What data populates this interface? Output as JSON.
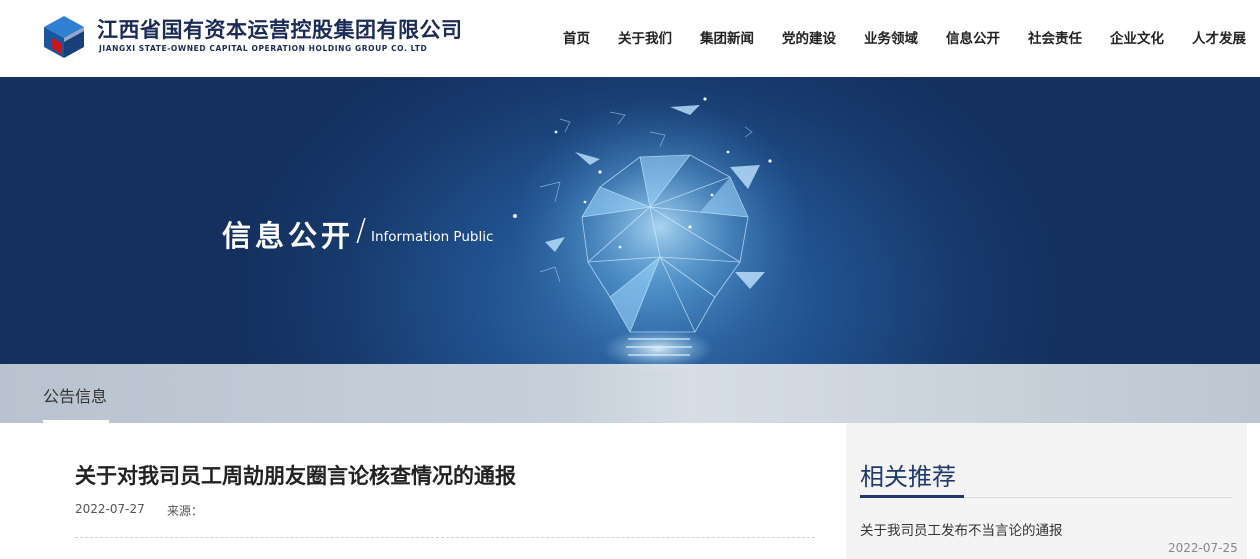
{
  "brand": {
    "name_cn": "江西省国有资本运营控股集团有限公司",
    "name_en": "JIANGXI STATE-OWNED CAPITAL OPERATION HOLDING GROUP CO. LTD"
  },
  "nav": {
    "items": [
      "首页",
      "关于我们",
      "集团新闻",
      "党的建设",
      "业务领域",
      "信息公开",
      "社会责任",
      "企业文化",
      "人才发展"
    ]
  },
  "banner": {
    "title": "信息公开",
    "subtitle": "Information Public"
  },
  "subnav": {
    "active_label": "公告信息"
  },
  "article": {
    "title": "关于对我司员工周劼朋友圈言论核查情况的通报",
    "date": "2022-07-27",
    "source_label": "来源："
  },
  "sidebar": {
    "title": "相关推荐",
    "items": [
      {
        "title": "关于我司员工发布不当言论的通报",
        "date": "2022-07-25"
      }
    ]
  },
  "colors": {
    "brand_navy": "#1b2b57",
    "logo_blue": "#1d62b3",
    "logo_red": "#c8161d",
    "banner_blue": "#17396c"
  }
}
